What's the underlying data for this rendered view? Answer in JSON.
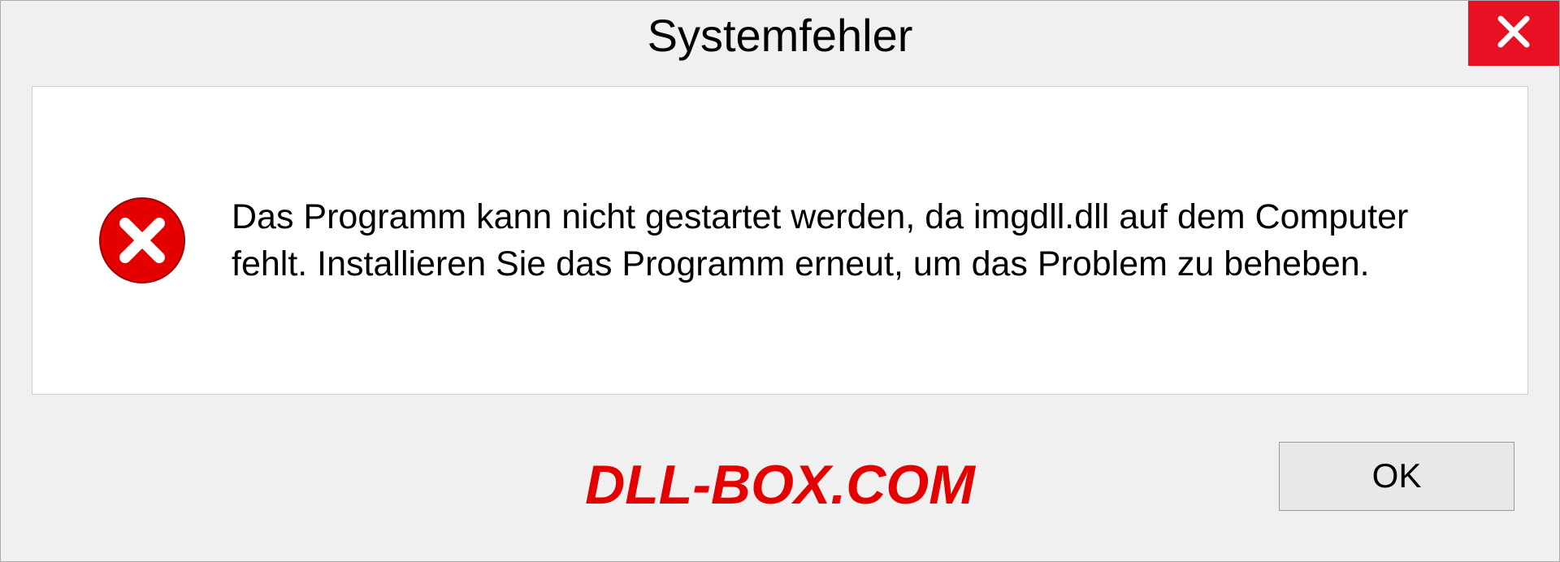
{
  "dialog": {
    "title": "Systemfehler",
    "message": "Das Programm kann nicht gestartet werden, da imgdll.dll auf dem Computer fehlt. Installieren Sie das Programm erneut, um das Problem zu beheben.",
    "ok_label": "OK"
  },
  "watermark": "DLL-BOX.COM"
}
